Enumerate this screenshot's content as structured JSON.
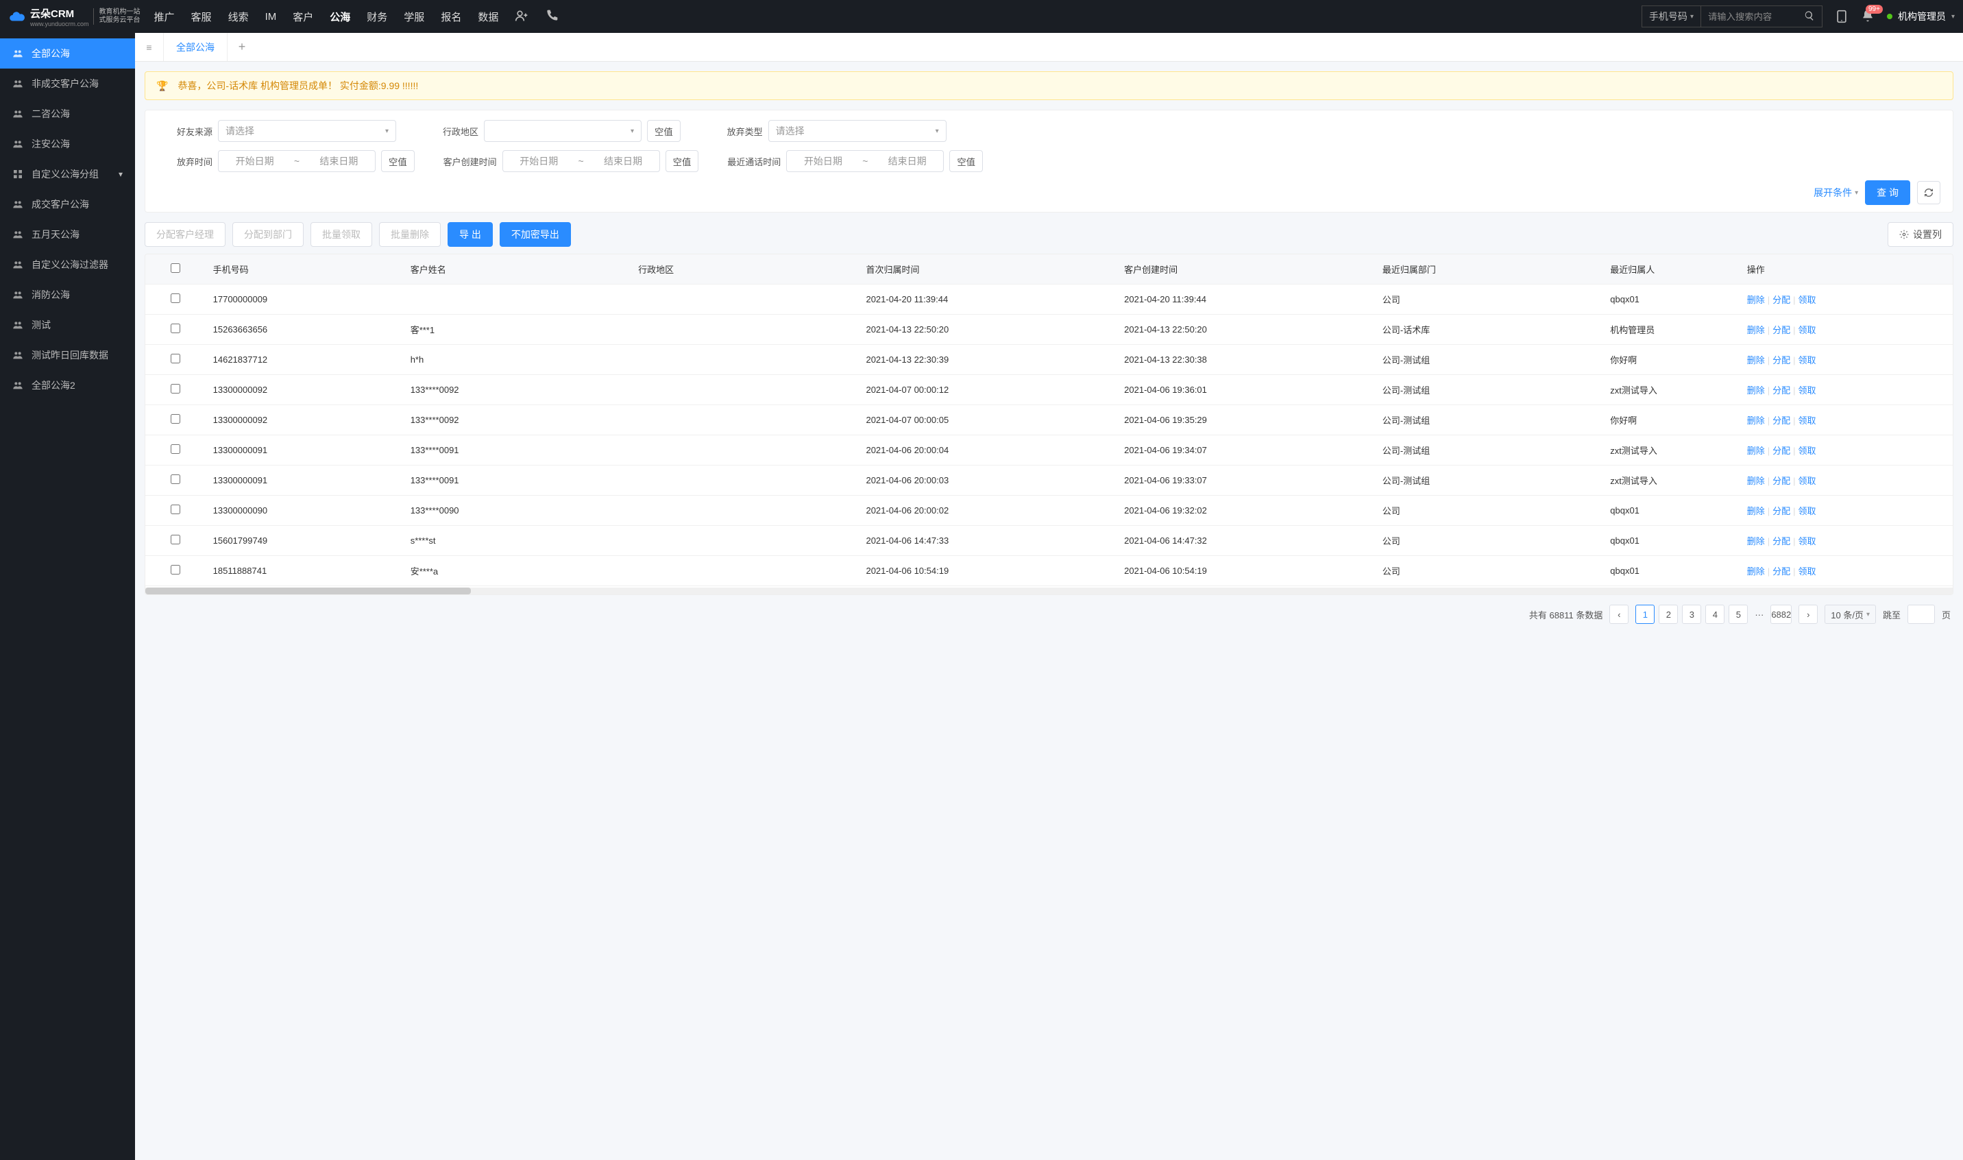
{
  "brand": {
    "name": "云朵CRM",
    "url": "www.yunduocrm.com",
    "tagline1": "教育机构一站",
    "tagline2": "式服务云平台"
  },
  "topmenu": [
    "推广",
    "客服",
    "线索",
    "IM",
    "客户",
    "公海",
    "财务",
    "学服",
    "报名",
    "数据"
  ],
  "topmenu_active": 5,
  "search": {
    "type": "手机号码",
    "placeholder": "请输入搜索内容"
  },
  "badge_count": "99+",
  "user_name": "机构管理员",
  "sidebar": [
    {
      "label": "全部公海",
      "active": true,
      "icon": "users"
    },
    {
      "label": "非成交客户公海",
      "icon": "users"
    },
    {
      "label": "二咨公海",
      "icon": "users"
    },
    {
      "label": "注安公海",
      "icon": "users"
    },
    {
      "label": "自定义公海分组",
      "icon": "grid",
      "expandable": true
    },
    {
      "label": "成交客户公海",
      "icon": "users"
    },
    {
      "label": "五月天公海",
      "icon": "users"
    },
    {
      "label": "自定义公海过滤器",
      "icon": "users"
    },
    {
      "label": "消防公海",
      "icon": "users"
    },
    {
      "label": "测试",
      "icon": "users"
    },
    {
      "label": "测试昨日回库数据",
      "icon": "users"
    },
    {
      "label": "全部公海2",
      "icon": "users"
    }
  ],
  "tab_label": "全部公海",
  "banner_text": "恭喜，公司-话术库  机构管理员成单！  实付金额:9.99 !!!!!!",
  "filters": {
    "source_label": "好友来源",
    "source_ph": "请选择",
    "region_label": "行政地区",
    "null_btn": "空值",
    "abandon_type_label": "放弃类型",
    "abandon_type_ph": "请选择",
    "abandon_time_label": "放弃时间",
    "start_ph": "开始日期",
    "end_ph": "结束日期",
    "create_time_label": "客户创建时间",
    "last_call_label": "最近通话时间",
    "expand": "展开条件",
    "query": "查 询"
  },
  "toolbar": {
    "assign_mgr": "分配客户经理",
    "assign_dept": "分配到部门",
    "bulk_claim": "批量领取",
    "bulk_delete": "批量删除",
    "export": "导 出",
    "export_plain": "不加密导出",
    "columns": "设置列"
  },
  "columns": [
    "手机号码",
    "客户姓名",
    "行政地区",
    "首次归属时间",
    "客户创建时间",
    "最近归属部门",
    "最近归属人",
    "操作"
  ],
  "ops": {
    "delete": "删除",
    "assign": "分配",
    "claim": "领取"
  },
  "rows": [
    {
      "phone": "17700000009",
      "name": "",
      "region": "",
      "first": "2021-04-20 11:39:44",
      "created": "2021-04-20 11:39:44",
      "dept": "公司",
      "person": "qbqx01"
    },
    {
      "phone": "15263663656",
      "name": "客***1",
      "region": "",
      "first": "2021-04-13 22:50:20",
      "created": "2021-04-13 22:50:20",
      "dept": "公司-话术库",
      "person": "机构管理员"
    },
    {
      "phone": "14621837712",
      "name": "h*h",
      "region": "",
      "first": "2021-04-13 22:30:39",
      "created": "2021-04-13 22:30:38",
      "dept": "公司-测试组",
      "person": "你好啊"
    },
    {
      "phone": "13300000092",
      "name": "133****0092",
      "region": "",
      "first": "2021-04-07 00:00:12",
      "created": "2021-04-06 19:36:01",
      "dept": "公司-测试组",
      "person": "zxt测试导入"
    },
    {
      "phone": "13300000092",
      "name": "133****0092",
      "region": "",
      "first": "2021-04-07 00:00:05",
      "created": "2021-04-06 19:35:29",
      "dept": "公司-测试组",
      "person": "你好啊"
    },
    {
      "phone": "13300000091",
      "name": "133****0091",
      "region": "",
      "first": "2021-04-06 20:00:04",
      "created": "2021-04-06 19:34:07",
      "dept": "公司-测试组",
      "person": "zxt测试导入"
    },
    {
      "phone": "13300000091",
      "name": "133****0091",
      "region": "",
      "first": "2021-04-06 20:00:03",
      "created": "2021-04-06 19:33:07",
      "dept": "公司-测试组",
      "person": "zxt测试导入"
    },
    {
      "phone": "13300000090",
      "name": "133****0090",
      "region": "",
      "first": "2021-04-06 20:00:02",
      "created": "2021-04-06 19:32:02",
      "dept": "公司",
      "person": "qbqx01"
    },
    {
      "phone": "15601799749",
      "name": "s****st",
      "region": "",
      "first": "2021-04-06 14:47:33",
      "created": "2021-04-06 14:47:32",
      "dept": "公司",
      "person": "qbqx01"
    },
    {
      "phone": "18511888741",
      "name": "安****a",
      "region": "",
      "first": "2021-04-06 10:54:19",
      "created": "2021-04-06 10:54:19",
      "dept": "公司",
      "person": "qbqx01"
    }
  ],
  "pager": {
    "total_prefix": "共有",
    "total": "68811",
    "total_suffix": "条数据",
    "pages": [
      "1",
      "2",
      "3",
      "4",
      "5"
    ],
    "last": "6882",
    "per_page": "10 条/页",
    "jump": "跳至",
    "unit": "页"
  }
}
